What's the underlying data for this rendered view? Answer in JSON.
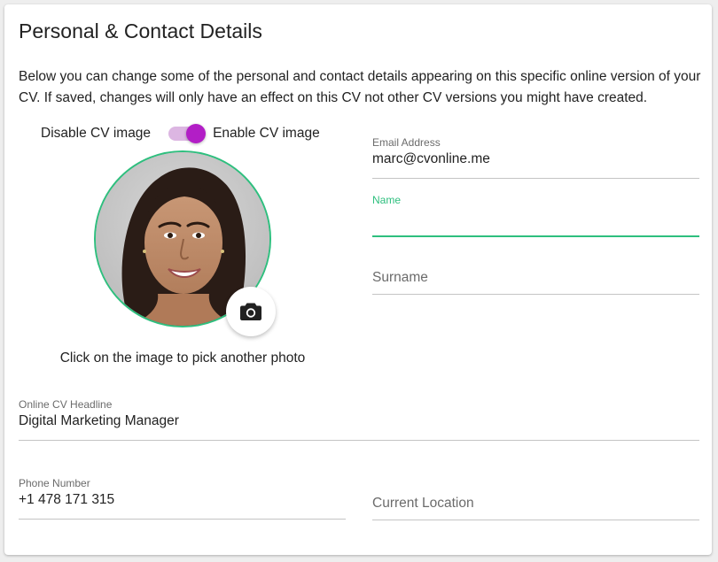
{
  "section": {
    "title": "Personal & Contact Details",
    "description": "Below you can change some of the personal and contact details appearing on this specific online version of your CV. If saved, changes will only have an effect on this CV not other CV versions you might have created."
  },
  "cv_image": {
    "disable_label": "Disable CV image",
    "enable_label": "Enable CV image",
    "enabled": true,
    "hint": "Click on the image to pick another photo",
    "camera_icon": "camera-icon"
  },
  "fields": {
    "email": {
      "label": "Email Address",
      "value": "marc@cvonline.me"
    },
    "name": {
      "label": "Name",
      "value": ""
    },
    "surname": {
      "placeholder": "Surname"
    },
    "headline": {
      "label": "Online CV Headline",
      "value": "Digital Marketing Manager"
    },
    "phone": {
      "label": "Phone Number",
      "value": "+1 478 171 315"
    },
    "location": {
      "placeholder": "Current Location"
    }
  },
  "colors": {
    "accent_green": "#2ebf7e",
    "toggle_purple": "#b21ec6",
    "toggle_track": "#dcb6e2"
  }
}
